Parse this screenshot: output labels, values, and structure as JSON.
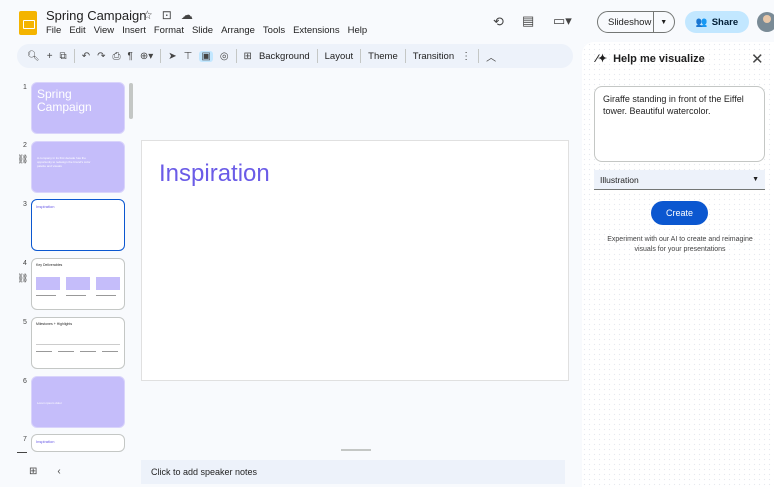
{
  "header": {
    "title": "Spring Campaign",
    "menu": [
      "File",
      "Edit",
      "View",
      "Insert",
      "Format",
      "Slide",
      "Arrange",
      "Tools",
      "Extensions",
      "Help"
    ],
    "slideshow_label": "Slideshow",
    "share_label": "Share"
  },
  "toolbar": {
    "background_label": "Background",
    "layout_label": "Layout",
    "theme_label": "Theme",
    "transition_label": "Transition"
  },
  "filmstrip": {
    "slides": [
      {
        "number": "1",
        "title": "Spring Campaign"
      },
      {
        "number": "2",
        "body": "A company in its first decade has the opportunity to redesign the brand's color palette and visuals"
      },
      {
        "number": "3",
        "title": "Inspiration"
      },
      {
        "number": "4",
        "title": "Key Deliverables"
      },
      {
        "number": "5",
        "title": "Milestones + Highlights"
      },
      {
        "number": "6",
        "body": "Lorem ipsum dolor"
      },
      {
        "number": "7",
        "title": "Inspiration"
      }
    ]
  },
  "slide": {
    "title": "Inspiration"
  },
  "notes": {
    "placeholder": "Click to add speaker notes"
  },
  "panel": {
    "title": "Help me visualize",
    "prompt": "Giraffe standing in front of the Eiffel tower. Beautiful watercolor.",
    "style": "Illustration",
    "create_label": "Create",
    "description": "Experiment with our AI to create and reimagine visuals for your presentations"
  },
  "colors": {
    "accent": "#0b57d0",
    "theme_purple": "#c5bdfa",
    "title_purple": "#6b5ce7",
    "logo_yellow": "#f4b400"
  }
}
